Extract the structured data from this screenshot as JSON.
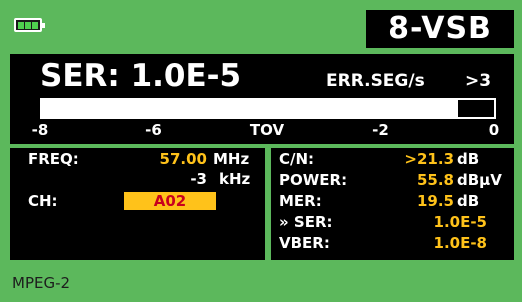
{
  "header": {
    "battery_icon": "battery-icon",
    "battery_level": 0.75,
    "modulation": "8-VSB"
  },
  "meter": {
    "ser_text": "SER: 1.0E-5",
    "errseg_label": "ERR.SEG/s",
    "errseg_value": ">3",
    "bar_fraction": 0.92,
    "scale": [
      "-8",
      "-6",
      "TOV",
      "-2",
      "0"
    ]
  },
  "left_panel": {
    "freq_label": "FREQ:",
    "freq_value": "57.00",
    "freq_unit": "MHz",
    "offset_value": "-3",
    "offset_unit": "kHz",
    "ch_label": "CH:",
    "ch_value": "A02"
  },
  "right_panel": {
    "cn_label": "C/N:",
    "cn_value": ">21.3",
    "cn_unit": "dB",
    "power_label": "POWER:",
    "power_value": "55.8",
    "power_unit": "dBµV",
    "mer_label": "MER:",
    "mer_value": "19.5",
    "mer_unit": "dB",
    "ser_label": "» SER:",
    "ser_value": "1.0E-5",
    "vber_label": "VBER:",
    "vber_value": "1.0E-8"
  },
  "footer": {
    "stream": "MPEG-2"
  },
  "colors": {
    "background": "#5cb85c",
    "panel": "#000000",
    "value": "#ffc21a",
    "channel_text": "#c8001e"
  }
}
